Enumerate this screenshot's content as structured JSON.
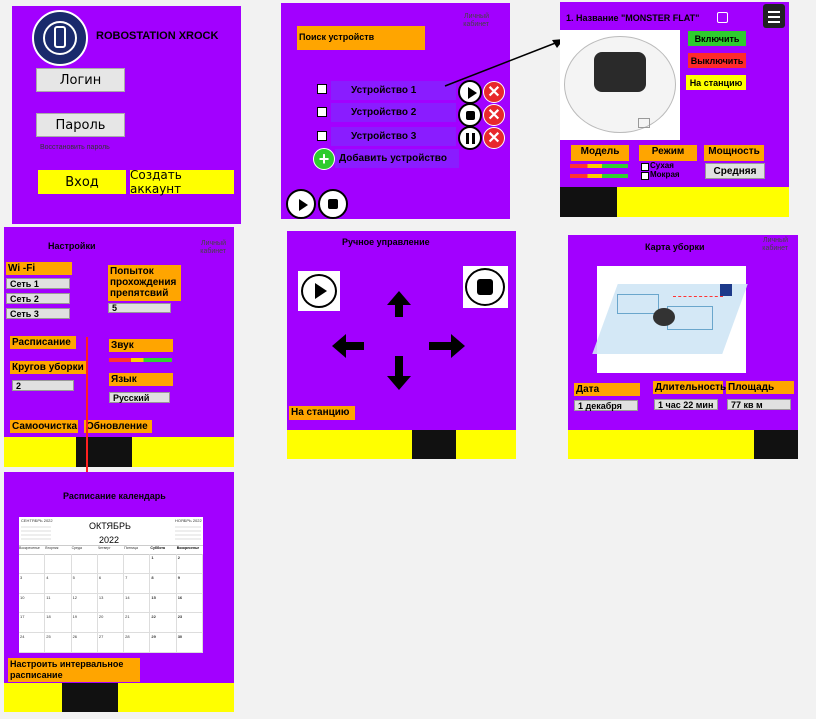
{
  "login": {
    "brand": "ROBOSTATION XROCK",
    "login_btn": "Логин",
    "password_btn": "Пароль",
    "restore": "Восстановить пароль",
    "enter_btn": "Вход",
    "create_btn": "Создать аккаунт"
  },
  "devices": {
    "cabinet": "Личный кабинет",
    "search": "Поиск устройств",
    "items": [
      "Устройство 1",
      "Устройство 2",
      "Устройство 3"
    ],
    "add": "Добавить устройство"
  },
  "detail": {
    "name": "1. Название  \"MONSTER FLAT\"",
    "on": "Включить",
    "off": "Выключить",
    "station": "На станцию",
    "model": "Модель",
    "mode": "Режим",
    "power": "Мощность",
    "dry": "Сухая",
    "wet": "Мокрая",
    "power_value": "Средняя"
  },
  "settings": {
    "title": "Настройки",
    "cabinet": "Личный кабинет",
    "wifi": "Wi -Fi",
    "networks": [
      "Сеть 1",
      "Сеть 2",
      "Сеть 3"
    ],
    "attempts_label": "Попыток прохождения препятсвий",
    "attempts_value": "5",
    "schedule": "Расписание",
    "sound": "Звук",
    "rounds_label": "Кругов уборки",
    "rounds_value": "2",
    "language": "Язык",
    "language_value": "Русский",
    "self_clean": "Самоочистка",
    "update": "Обновление"
  },
  "manual": {
    "title": "Ручное управление",
    "station": "На станцию"
  },
  "map": {
    "title": "Карта уборки",
    "cabinet": "Личный кабинет",
    "date_label": "Дата",
    "date_value": "1 декабря",
    "duration_label": "Длительность",
    "duration_value": "1 час 22 мин",
    "area_label": "Площадь",
    "area_value": "77 кв м"
  },
  "calendar": {
    "title": "Расписание календарь",
    "month": "ОКТЯБРЬ",
    "year": "2022",
    "prev_mini": "СЕНТЯБРЬ   2022",
    "next_mini": "НОЯБРЬ   2022",
    "weekdays": [
      "Воскресенье",
      "Вторник",
      "Среда",
      "Четверг",
      "Пятница",
      "Суббота",
      "Воскресенье"
    ],
    "days": [
      "",
      "",
      "",
      "",
      "",
      "1",
      "2",
      "3",
      "4",
      "5",
      "6",
      "7",
      "8",
      "9",
      "10",
      "11",
      "12",
      "13",
      "14",
      "15",
      "16",
      "17",
      "18",
      "19",
      "20",
      "21",
      "22",
      "23",
      "24",
      "25",
      "26",
      "27",
      "28",
      "29",
      "30"
    ],
    "interval": "Настроить интервальное расписание"
  },
  "colors": {
    "screen": "#a200ff",
    "accent_orange": "#ffa500",
    "accent_yellow": "#ffff00",
    "on_green": "#2ecc2e",
    "off_red": "#ff2a2a"
  }
}
